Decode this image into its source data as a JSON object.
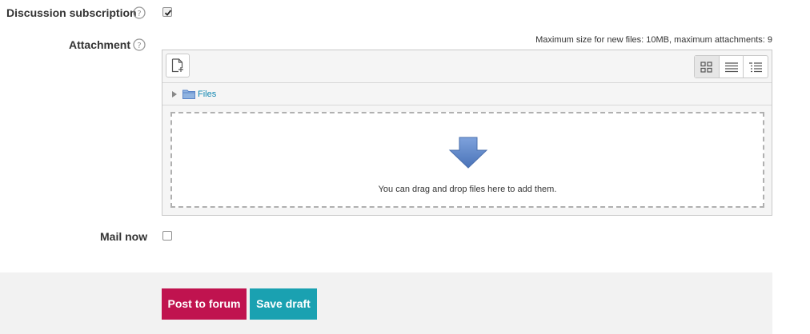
{
  "form": {
    "discussion_subscription": {
      "label": "Discussion subscription",
      "checked": true
    },
    "attachment": {
      "label": "Attachment",
      "max_size_text": "Maximum size for new files: 10MB, maximum attachments: 9",
      "files_label": "Files",
      "drop_text": "You can drag and drop files here to add them."
    },
    "mail_now": {
      "label": "Mail now",
      "checked": false
    }
  },
  "footer": {
    "post_label": "Post to forum",
    "draft_label": "Save draft"
  },
  "colors": {
    "primary": "#c0134f",
    "secondary": "#1aa1b1",
    "link": "#0f86b1",
    "drop_arrow": "#5b86c9"
  },
  "icons": {
    "help": "help-circle-icon",
    "add_file": "add-file-icon",
    "view_icons": "grid-view-icon",
    "view_list": "list-view-icon",
    "view_tree": "tree-view-icon",
    "folder": "folder-icon",
    "expand": "triangle-right-icon",
    "drop": "drop-arrow-icon"
  }
}
